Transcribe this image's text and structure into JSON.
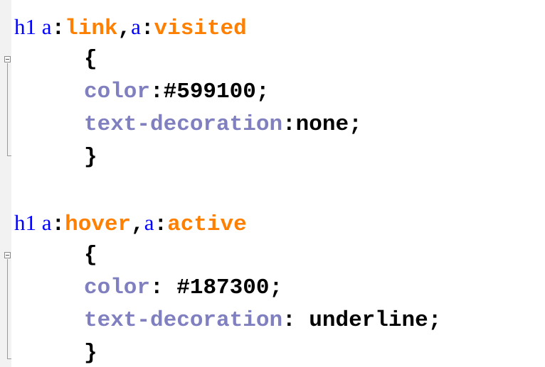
{
  "editor": {
    "blocks": [
      {
        "selector": {
          "tag": "h1",
          "element1": "a",
          "colon1": ":",
          "pseudo1": "link",
          "comma": ",",
          "element2": "a",
          "colon2": ":",
          "pseudo2": "visited"
        },
        "open_brace": "{",
        "declarations": [
          {
            "property": "color",
            "colon": ":",
            "value": "#599100",
            "semicolon": ";"
          },
          {
            "property": "text-decoration",
            "colon": ":",
            "value": "none",
            "semicolon": ";"
          }
        ],
        "close_brace": "}"
      },
      {
        "selector": {
          "tag": "h1",
          "element1": "a",
          "colon1": ":",
          "pseudo1": "hover",
          "comma": ",",
          "element2": "a",
          "colon2": ":",
          "pseudo2": "active"
        },
        "open_brace": "{",
        "declarations": [
          {
            "property": "color",
            "colon": ": ",
            "value": "#187300",
            "semicolon": ";"
          },
          {
            "property": "text-decoration",
            "colon": ": ",
            "value": "underline",
            "semicolon": ";"
          }
        ],
        "close_brace": "}"
      }
    ]
  },
  "colors": {
    "selector": "#0000ff",
    "pseudo_class": "#ff8000",
    "property": "#8080c0",
    "value": "#000000",
    "gutter": "#f2f2f2"
  },
  "icons": [
    "fold-collapse-icon",
    "fold-collapse-icon"
  ]
}
